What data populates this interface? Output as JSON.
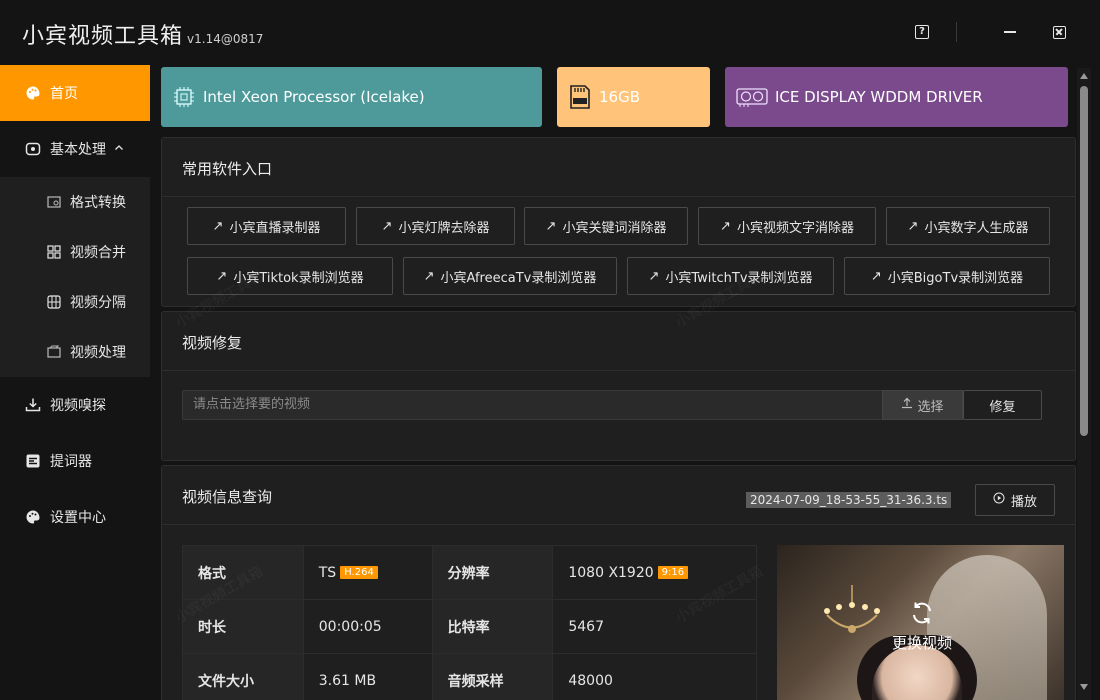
{
  "app": {
    "title": "小宾视频工具箱",
    "version": "v1.14@0817"
  },
  "window_controls": {
    "help_glyph": "?",
    "icons": [
      "help-icon",
      "minimize-icon",
      "close-icon"
    ]
  },
  "sidebar": {
    "items": [
      {
        "label": "首页",
        "icon": "palette-icon",
        "active": true
      },
      {
        "label": "基本处理",
        "icon": "circle-box-icon",
        "expanded": true
      },
      {
        "label": "视频嗅探",
        "icon": "download-tray-icon"
      },
      {
        "label": "提词器",
        "icon": "text-box-icon"
      },
      {
        "label": "设置中心",
        "icon": "palette-icon"
      }
    ],
    "sub_items": [
      {
        "label": "格式转换",
        "icon": "convert-icon"
      },
      {
        "label": "视频合并",
        "icon": "grid-icon"
      },
      {
        "label": "视频分隔",
        "icon": "film-split-icon"
      },
      {
        "label": "视频处理",
        "icon": "film-process-icon"
      }
    ]
  },
  "stats": {
    "cpu": "Intel Xeon Processor (Icelake)",
    "memory": "16GB",
    "gpu": "ICE DISPLAY WDDM DRIVER",
    "colors": {
      "cpu": "#4e9a9b",
      "memory": "#ffc47a",
      "gpu": "#7a4a8c"
    }
  },
  "software": {
    "title": "常用软件入口",
    "row1": [
      "小宾直播录制器",
      "小宾灯牌去除器",
      "小宾关键词消除器",
      "小宾视频文字消除器",
      "小宾数字人生成器"
    ],
    "row2": [
      "小宾Tiktok录制浏览器",
      "小宾AfreecaTv录制浏览器",
      "小宾TwitchTv录制浏览器",
      "小宾BigoTv录制浏览器"
    ],
    "arrow_glyph": "↗"
  },
  "repair": {
    "title": "视频修复",
    "placeholder": "请点击选择要的视频",
    "choose_label": "选择",
    "repair_label": "修复"
  },
  "info": {
    "title": "视频信息查询",
    "filename": "2024-07-09_18-53-55_31-36.3.ts",
    "play_label": "播放",
    "rows": [
      {
        "l1": "格式",
        "v1": "TS",
        "t1": "H.264",
        "l2": "分辨率",
        "v2": "1080 X1920",
        "t2": "9:16"
      },
      {
        "l1": "时长",
        "v1": "00:00:05",
        "t1": "",
        "l2": "比特率",
        "v2": "5467",
        "t2": ""
      },
      {
        "l1": "文件大小",
        "v1": "3.61 MB",
        "t1": "",
        "l2": "音频采样",
        "v2": "48000",
        "t2": ""
      }
    ],
    "swap_label": "更换视频"
  },
  "watermark_text": "小宾视频工具箱",
  "accent": "#ff9800"
}
